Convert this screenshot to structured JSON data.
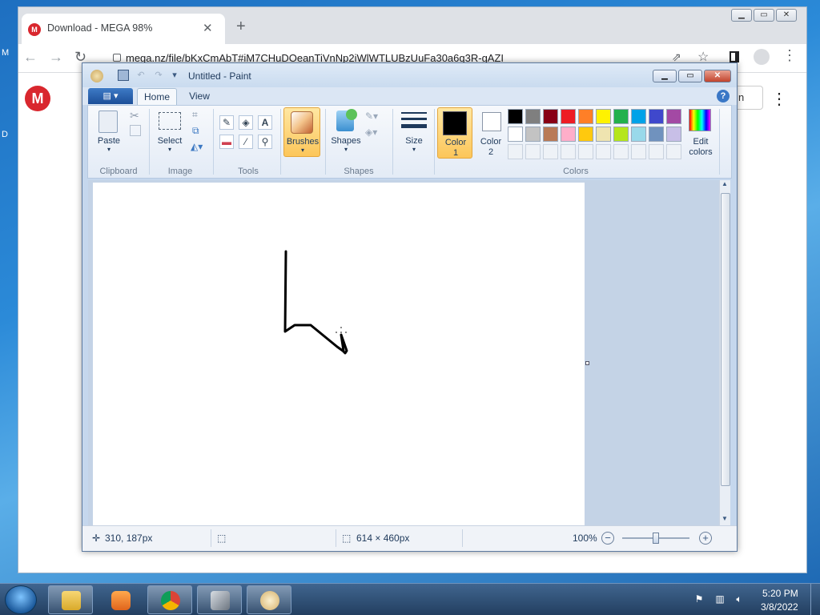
{
  "chrome": {
    "tab_title": "Download - MEGA 98%",
    "tab_close": "✕",
    "new_tab": "+",
    "url": "mega.nz/file/bKxCmAbT#iM7CHuDOeanTiVnNp2iWlWTLUBzUuFa30a6q3R-gAZI",
    "mega_logo": "M",
    "partial_text": "n",
    "kebab": "⋮"
  },
  "paint": {
    "title": "Untitled - Paint",
    "tabs": {
      "home": "Home",
      "view": "View"
    },
    "groups": {
      "clipboard": {
        "label": "Clipboard",
        "paste": "Paste"
      },
      "image": {
        "label": "Image",
        "select": "Select"
      },
      "tools": {
        "label": "Tools"
      },
      "brushes": "Brushes",
      "shapes": {
        "label": "Shapes",
        "shapes": "Shapes"
      },
      "size": "Size",
      "colors": {
        "label": "Colors",
        "color1_a": "Color",
        "color1_b": "1",
        "color2_a": "Color",
        "color2_b": "2",
        "edit_a": "Edit",
        "edit_b": "colors"
      }
    },
    "palette_row1": [
      "#000000",
      "#7f7f7f",
      "#880015",
      "#ed1c24",
      "#ff7f27",
      "#fff200",
      "#22b14c",
      "#00a2e8",
      "#3f48cc",
      "#a349a4"
    ],
    "palette_row2": [
      "#ffffff",
      "#c3c3c3",
      "#b97a57",
      "#ffaec9",
      "#ffc90e",
      "#efe4b0",
      "#b5e61d",
      "#99d9ea",
      "#7092be",
      "#c8bfe7"
    ],
    "color1": "#000000",
    "color2": "#ffffff",
    "status": {
      "cursor": "310, 187px",
      "size": "614 × 460px",
      "zoom": "100%"
    }
  },
  "taskbar": {
    "time": "5:20 PM",
    "date": "3/8/2022"
  }
}
